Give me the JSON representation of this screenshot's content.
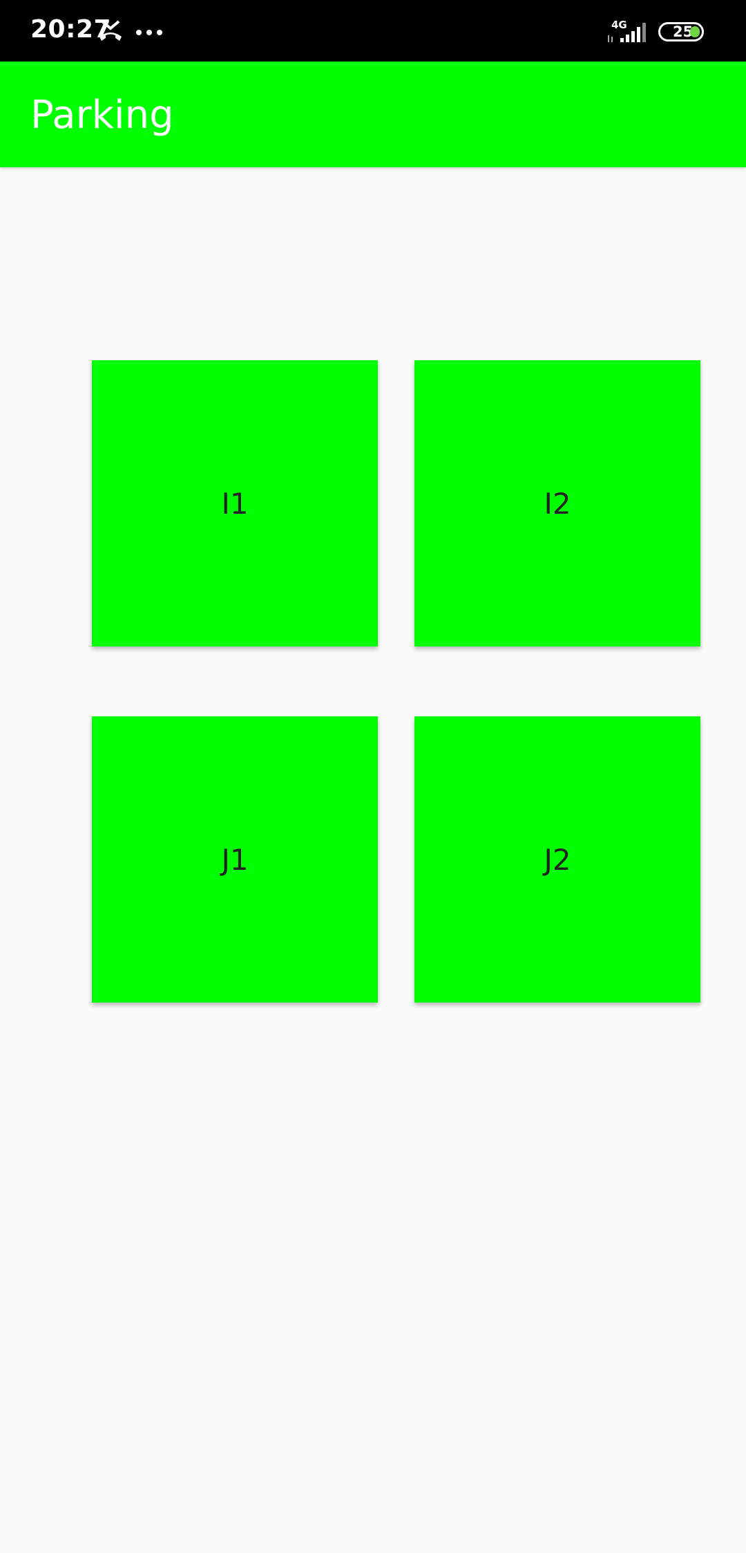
{
  "status_bar": {
    "time": "20:27",
    "network_type": "4G",
    "battery_level": "25",
    "icons": [
      "call-missed-icon",
      "more-dots-icon",
      "signal-icon",
      "battery-icon"
    ]
  },
  "app_bar": {
    "title": "Parking"
  },
  "spots": [
    {
      "label": "I1"
    },
    {
      "label": "I2"
    },
    {
      "label": "J1"
    },
    {
      "label": "J2"
    }
  ],
  "colors": {
    "app_bar": "#00ff00",
    "spot": "#00ff00",
    "background": "#fafafa",
    "status_bar": "#000000"
  }
}
